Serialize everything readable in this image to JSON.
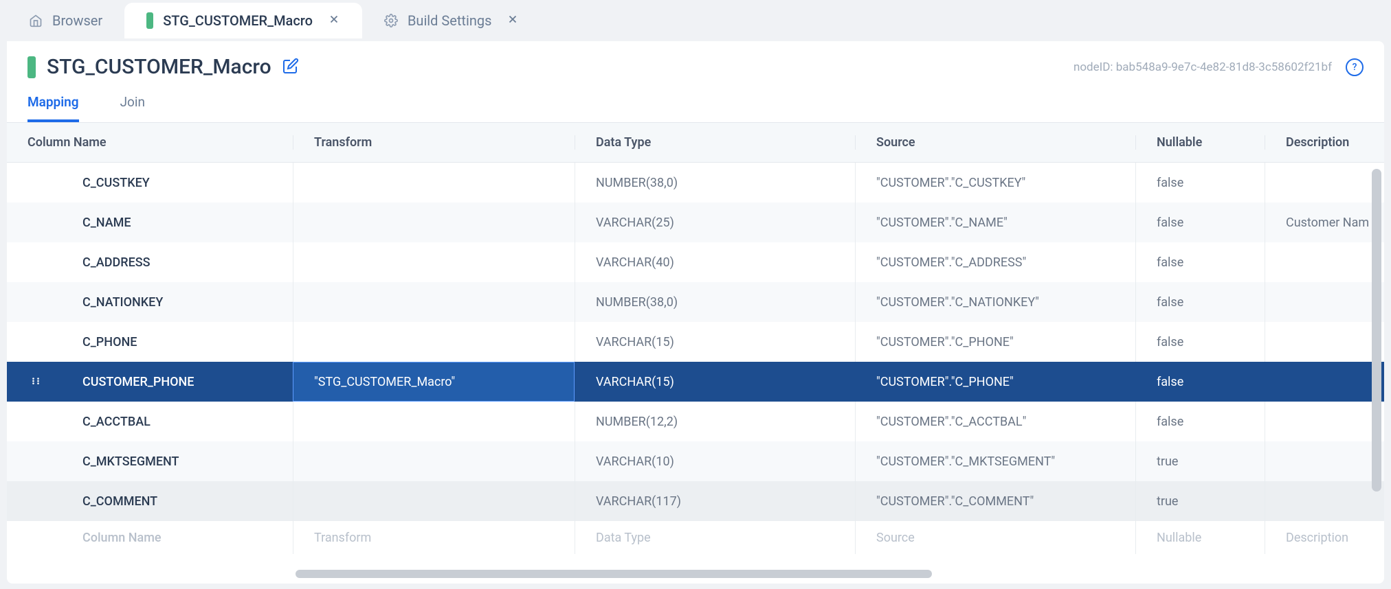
{
  "tabs": [
    {
      "label": "Browser",
      "icon": "home"
    },
    {
      "label": "STG_CUSTOMER_Macro",
      "icon": "green-indicator",
      "active": true
    },
    {
      "label": "Build Settings",
      "icon": "gear"
    }
  ],
  "page_title": "STG_CUSTOMER_Macro",
  "node_id": "nodeID: bab548a9-9e7c-4e82-81d8-3c58602f21bf",
  "sub_tabs": [
    {
      "label": "Mapping",
      "active": true
    },
    {
      "label": "Join"
    }
  ],
  "columns": {
    "col1": "Column Name",
    "col2": "Transform",
    "col3": "Data Type",
    "col4": "Source",
    "col5": "Nullable",
    "col6": "Description"
  },
  "rows": [
    {
      "name": "C_CUSTKEY",
      "transform": "",
      "dataType": "NUMBER(38,0)",
      "source": "\"CUSTOMER\".\"C_CUSTKEY\"",
      "nullable": "false",
      "description": ""
    },
    {
      "name": "C_NAME",
      "transform": "",
      "dataType": "VARCHAR(25)",
      "source": "\"CUSTOMER\".\"C_NAME\"",
      "nullable": "false",
      "description": "Customer Nam"
    },
    {
      "name": "C_ADDRESS",
      "transform": "",
      "dataType": "VARCHAR(40)",
      "source": "\"CUSTOMER\".\"C_ADDRESS\"",
      "nullable": "false",
      "description": ""
    },
    {
      "name": "C_NATIONKEY",
      "transform": "",
      "dataType": "NUMBER(38,0)",
      "source": "\"CUSTOMER\".\"C_NATIONKEY\"",
      "nullable": "false",
      "description": ""
    },
    {
      "name": "C_PHONE",
      "transform": "",
      "dataType": "VARCHAR(15)",
      "source": "\"CUSTOMER\".\"C_PHONE\"",
      "nullable": "false",
      "description": ""
    },
    {
      "name": "CUSTOMER_PHONE",
      "transform": "\"STG_CUSTOMER_Macro\"",
      "dataType": "VARCHAR(15)",
      "source": "\"CUSTOMER\".\"C_PHONE\"",
      "nullable": "false",
      "description": "",
      "selected": true
    },
    {
      "name": "C_ACCTBAL",
      "transform": "",
      "dataType": "NUMBER(12,2)",
      "source": "\"CUSTOMER\".\"C_ACCTBAL\"",
      "nullable": "false",
      "description": ""
    },
    {
      "name": "C_MKTSEGMENT",
      "transform": "",
      "dataType": "VARCHAR(10)",
      "source": "\"CUSTOMER\".\"C_MKTSEGMENT\"",
      "nullable": "true",
      "description": ""
    },
    {
      "name": "C_COMMENT",
      "transform": "",
      "dataType": "VARCHAR(117)",
      "source": "\"CUSTOMER\".\"C_COMMENT\"",
      "nullable": "true",
      "description": ""
    }
  ],
  "placeholders": {
    "col1": "Column Name",
    "col2": "Transform",
    "col3": "Data Type",
    "col4": "Source",
    "col5": "Nullable",
    "col6": "Description"
  }
}
